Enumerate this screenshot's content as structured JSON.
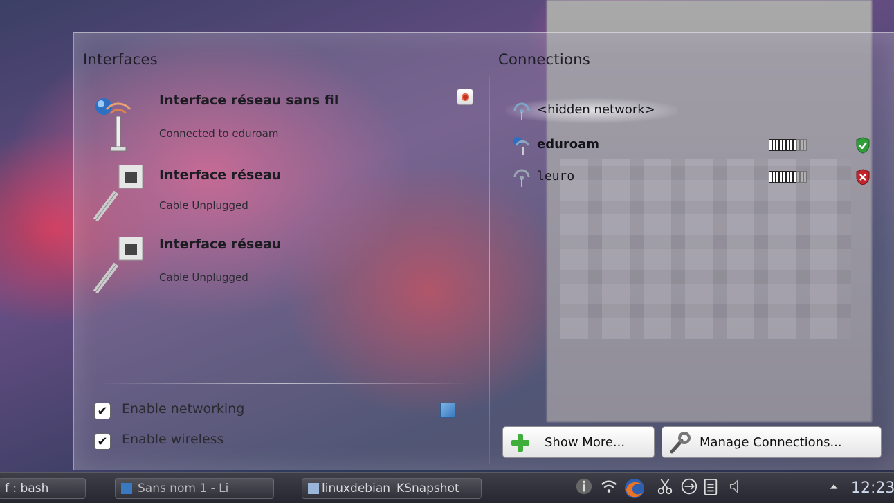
{
  "interfaces": {
    "title": "Interfaces",
    "items": [
      {
        "name": "Interface réseau sans fil",
        "status": "Connected to eduroam",
        "icon": "wireless-interface-icon"
      },
      {
        "name": "Interface réseau",
        "status": "Cable Unplugged",
        "icon": "wired-interface-icon"
      },
      {
        "name": "Interface réseau",
        "status": "Cable Unplugged",
        "icon": "wired-interface-icon"
      }
    ]
  },
  "connections": {
    "title": "Connections",
    "items": [
      {
        "name": "<hidden network>",
        "icon": "wireless-signal-icon"
      },
      {
        "name": "eduroam",
        "icon": "wireless-connected-icon",
        "signal_bars": 8,
        "signal_total": 11,
        "security": "secure-shield-icon"
      },
      {
        "name": "leuro",
        "icon": "wireless-signal-icon",
        "signal_bars": 8,
        "signal_total": 11,
        "security": "insecure-shield-icon"
      }
    ]
  },
  "options": {
    "enable_networking": "Enable networking",
    "enable_wireless": "Enable wireless"
  },
  "buttons": {
    "show_more": "Show More...",
    "manage_connections": "Manage Connections..."
  },
  "taskbar": {
    "tasks": [
      {
        "label": "f : bash"
      },
      {
        "label": "Sans nom 1 - Li"
      },
      {
        "label": "linuxdebian"
      },
      {
        "label": "KSnapshot"
      }
    ],
    "clock": "12:23"
  },
  "colors": {
    "secure": "#2f9e3a",
    "insecure": "#c4242b",
    "accent": "#3a78bf"
  }
}
